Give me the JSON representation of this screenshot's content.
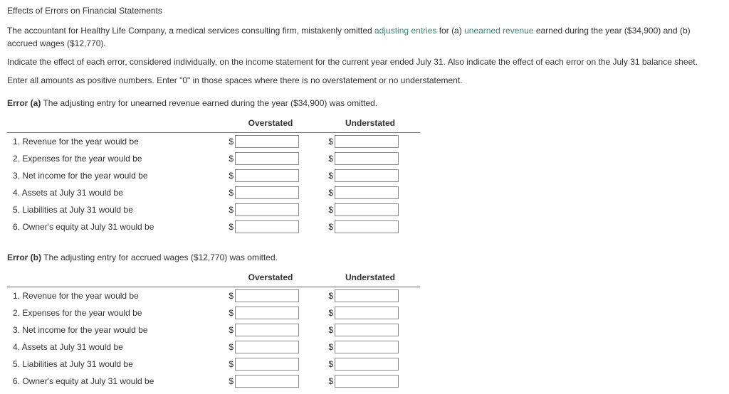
{
  "title": "Effects of Errors on Financial Statements",
  "intro1_pre": "The accountant for Healthy Life Company, a medical services consulting firm, mistakenly omitted ",
  "intro1_link1": "adjusting entries",
  "intro1_mid1": " for (a) ",
  "intro1_link2": "unearned revenue",
  "intro1_post": " earned during the year ($34,900) and (b) accrued wages ($12,770).",
  "intro2": "Indicate the effect of each error, considered individually, on the income statement for the current year ended July 31. Also indicate the effect of each error on the July 31 balance sheet.",
  "intro3": "Enter all amounts as positive numbers. Enter \"0\" in those spaces where there is no overstatement or no understatement.",
  "errorA_bold": "Error (a)",
  "errorA_text": " The adjusting entry for unearned revenue earned during the year ($34,900) was omitted.",
  "errorB_bold": "Error (b)",
  "errorB_text": " The adjusting entry for accrued wages ($12,770) was omitted.",
  "col_over": "Overstated",
  "col_under": "Understated",
  "currency": "$",
  "rows": [
    "1.  Revenue for the year would be",
    "2.  Expenses for the year would be",
    "3.  Net income for the year would be",
    "4.  Assets at July 31 would be",
    "5.  Liabilities at July 31 would be",
    "6.  Owner's equity at July 31 would be"
  ]
}
